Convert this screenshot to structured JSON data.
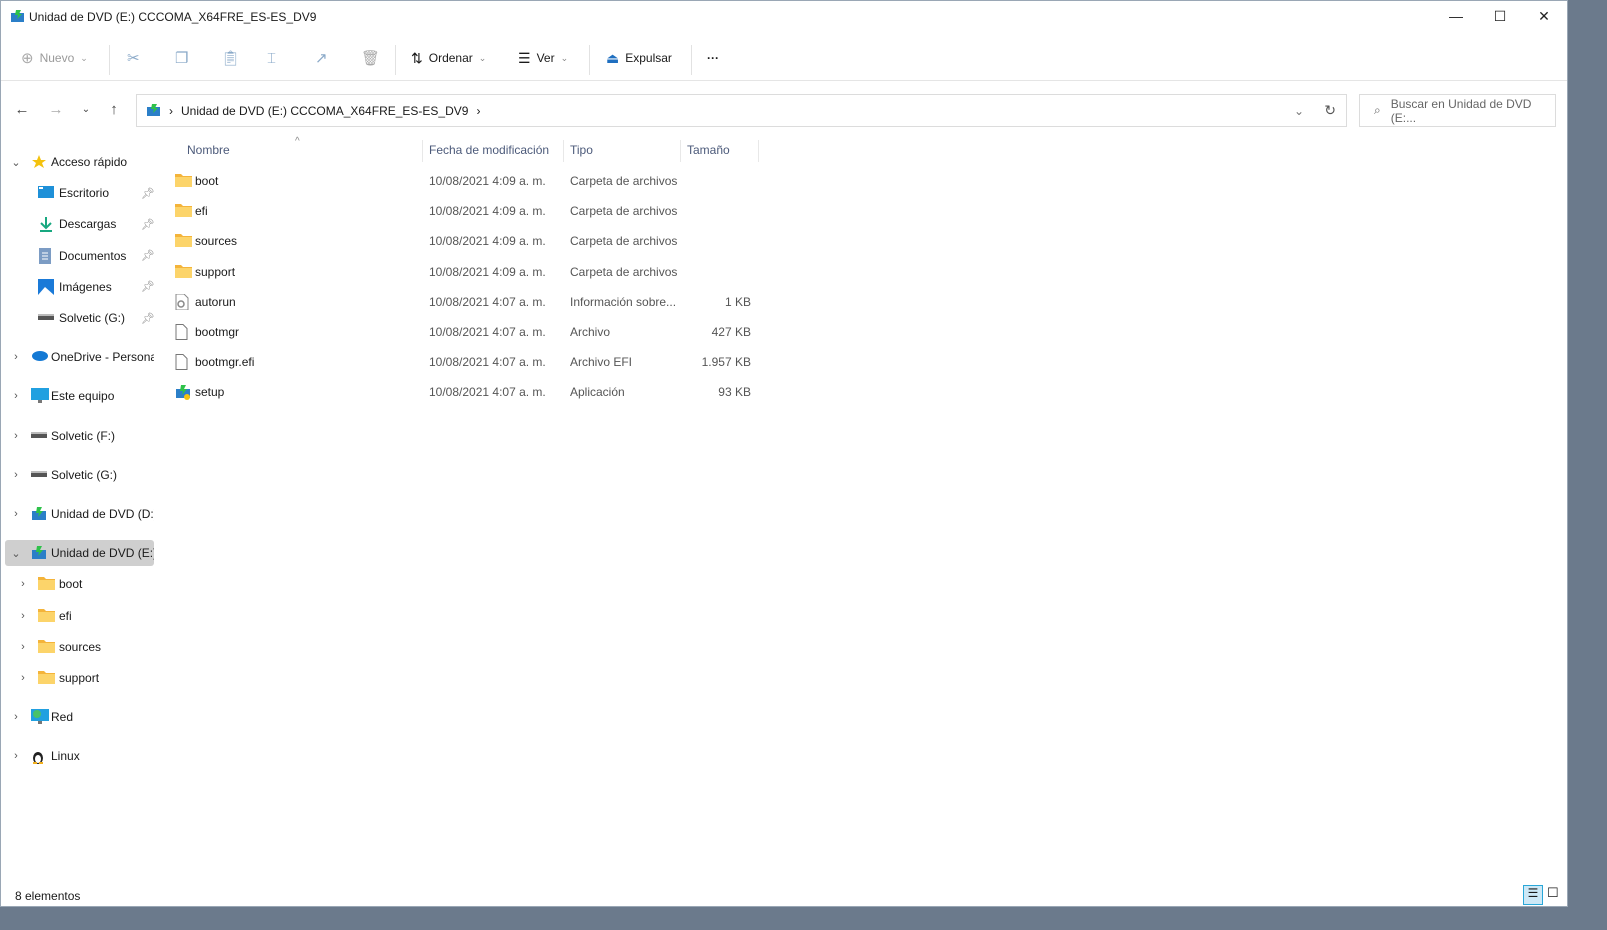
{
  "window": {
    "title": "Unidad de DVD (E:) CCCOMA_X64FRE_ES-ES_DV9",
    "minimize": "—",
    "maximize": "☐",
    "close": "✕"
  },
  "toolbar": {
    "new": "Nuevo",
    "sort": "Ordenar",
    "view": "Ver",
    "eject": "Expulsar",
    "more": "···"
  },
  "address": {
    "path": "Unidad de DVD (E:) CCCOMA_X64FRE_ES-ES_DV9",
    "search_placeholder": "Buscar en Unidad de DVD (E:..."
  },
  "columns": {
    "name": "Nombre",
    "date": "Fecha de modificación",
    "type": "Tipo",
    "size": "Tamaño"
  },
  "sidebar": [
    {
      "label": "Acceso rápido",
      "icon": "star-icon",
      "level": 0,
      "chev": "⌄"
    },
    {
      "label": "Escritorio",
      "icon": "desktop-icon",
      "level": 1,
      "pin": true
    },
    {
      "label": "Descargas",
      "icon": "download-icon",
      "level": 1,
      "pin": true
    },
    {
      "label": "Documentos",
      "icon": "documents-icon",
      "level": 1,
      "pin": true
    },
    {
      "label": "Imágenes",
      "icon": "pictures-icon",
      "level": 1,
      "pin": true
    },
    {
      "label": "Solvetic (G:)",
      "icon": "drive-icon",
      "level": 1,
      "pin": true
    },
    {
      "label": "OneDrive - Personal",
      "icon": "cloud-icon",
      "level": 0,
      "chev": "›",
      "gap": true
    },
    {
      "label": "Este equipo",
      "icon": "computer-icon",
      "level": 0,
      "chev": "›",
      "gap": true
    },
    {
      "label": "Solvetic (F:)",
      "icon": "drive-icon",
      "level": 0,
      "chev": "›",
      "gap": true
    },
    {
      "label": "Solvetic (G:)",
      "icon": "drive-icon",
      "level": 0,
      "chev": "›",
      "gap": true
    },
    {
      "label": "Unidad de DVD (D:)",
      "icon": "dvd-icon",
      "level": 0,
      "chev": "›",
      "gap": true
    },
    {
      "label": "Unidad de DVD (E:) CCCOMA",
      "icon": "dvd-icon",
      "level": 0,
      "chev": "⌄",
      "gap": true,
      "selected": true
    },
    {
      "label": "boot",
      "icon": "folder-icon",
      "level": 1,
      "chev": "›"
    },
    {
      "label": "efi",
      "icon": "folder-icon",
      "level": 1,
      "chev": "›"
    },
    {
      "label": "sources",
      "icon": "folder-icon",
      "level": 1,
      "chev": "›"
    },
    {
      "label": "support",
      "icon": "folder-icon",
      "level": 1,
      "chev": "›"
    },
    {
      "label": "Red",
      "icon": "network-icon",
      "level": 0,
      "chev": "›",
      "gap": true
    },
    {
      "label": "Linux",
      "icon": "linux-icon",
      "level": 0,
      "chev": "›",
      "gap": true
    }
  ],
  "files": [
    {
      "name": "boot",
      "date": "10/08/2021 4:09 a. m.",
      "type": "Carpeta de archivos",
      "size": "",
      "icon": "folder-icon"
    },
    {
      "name": "efi",
      "date": "10/08/2021 4:09 a. m.",
      "type": "Carpeta de archivos",
      "size": "",
      "icon": "folder-icon"
    },
    {
      "name": "sources",
      "date": "10/08/2021 4:09 a. m.",
      "type": "Carpeta de archivos",
      "size": "",
      "icon": "folder-icon"
    },
    {
      "name": "support",
      "date": "10/08/2021 4:09 a. m.",
      "type": "Carpeta de archivos",
      "size": "",
      "icon": "folder-icon"
    },
    {
      "name": "autorun",
      "date": "10/08/2021 4:07 a. m.",
      "type": "Información sobre...",
      "size": "1 KB",
      "icon": "settings-file-icon"
    },
    {
      "name": "bootmgr",
      "date": "10/08/2021 4:07 a. m.",
      "type": "Archivo",
      "size": "427 KB",
      "icon": "file-icon"
    },
    {
      "name": "bootmgr.efi",
      "date": "10/08/2021 4:07 a. m.",
      "type": "Archivo EFI",
      "size": "1.957 KB",
      "icon": "file-icon"
    },
    {
      "name": "setup",
      "date": "10/08/2021 4:07 a. m.",
      "type": "Aplicación",
      "size": "93 KB",
      "icon": "setup-icon"
    }
  ],
  "status": {
    "count": "8 elementos"
  }
}
